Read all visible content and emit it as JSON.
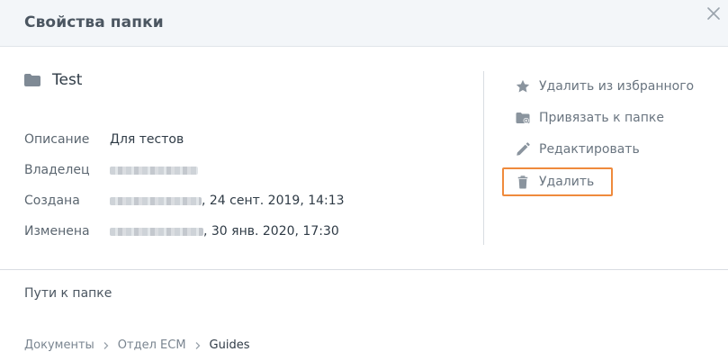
{
  "dialog": {
    "title": "Свойства папки"
  },
  "folder": {
    "name": "Test",
    "icon": "folder-icon"
  },
  "properties": [
    {
      "label": "Описание",
      "value": "Для тестов",
      "blurred": false
    },
    {
      "label": "Владелец",
      "value": "",
      "blurred": true
    },
    {
      "label": "Создана",
      "value": ", 24 сент. 2019, 14:13",
      "blurred": true
    },
    {
      "label": "Изменена",
      "value": ", 30 янв. 2020, 17:30",
      "blurred": true
    }
  ],
  "actions": [
    {
      "label": "Удалить из избранного",
      "icon": "star-icon"
    },
    {
      "label": "Привязать к папке",
      "icon": "folder-link-icon"
    },
    {
      "label": "Редактировать",
      "icon": "pencil-icon"
    },
    {
      "label": "Удалить",
      "icon": "trash-icon"
    }
  ],
  "paths": {
    "title": "Пути к папке",
    "breadcrumb": [
      "Документы",
      "Отдел ECM",
      "Guides"
    ]
  },
  "colors": {
    "header_bg": "#f3f6f9",
    "highlight": "#ef8a3c",
    "icon": "#8a949e"
  }
}
